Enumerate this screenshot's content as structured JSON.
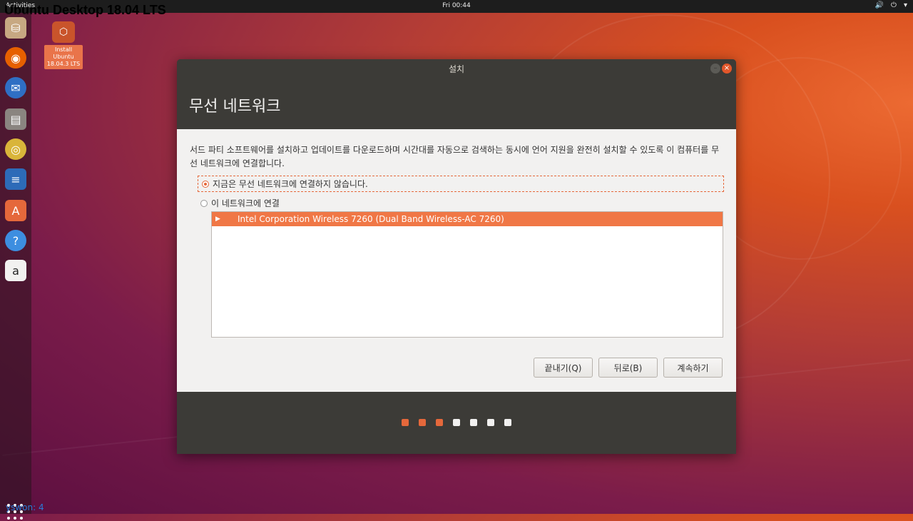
{
  "overlay_title": "Ubuntu Desktop 18.04 LTS",
  "topbar": {
    "activities": "Activities",
    "clock": "Fri 00:44"
  },
  "desktop": {
    "install_label": "Install Ubuntu 18.04.3 LTS"
  },
  "dock": {
    "items": [
      "disk-installer-icon",
      "firefox-icon",
      "thunderbird-icon",
      "files-icon",
      "rhythmbox-icon",
      "writer-icon",
      "software-center-icon",
      "help-icon",
      "amazon-icon"
    ]
  },
  "user_line": "yswon:   4",
  "window": {
    "title": "설치",
    "heading": "무선 네트워크",
    "description": "서드 파티 소프트웨어를 설치하고 업데이트를 다운로드하며 시간대를 자동으로 검색하는 동시에 언어 지원을 완전히 설치할 수 있도록 이 컴퓨터를 무선 네트워크에 연결합니다.",
    "option_no_connect": "지금은 무선 네트워크에 연결하지 않습니다.",
    "option_connect": "이 네트워크에 연결",
    "networks": [
      {
        "name": "Intel Corporation Wireless 7260 (Dual Band Wireless-AC 7260)"
      }
    ],
    "buttons": {
      "quit": "끝내기(Q)",
      "back": "뒤로(B)",
      "continue": "계속하기"
    },
    "progress_steps_total": 7,
    "progress_steps_done": 3
  },
  "colors": {
    "accent": "#e5683b",
    "window_dark": "#3c3b37"
  }
}
